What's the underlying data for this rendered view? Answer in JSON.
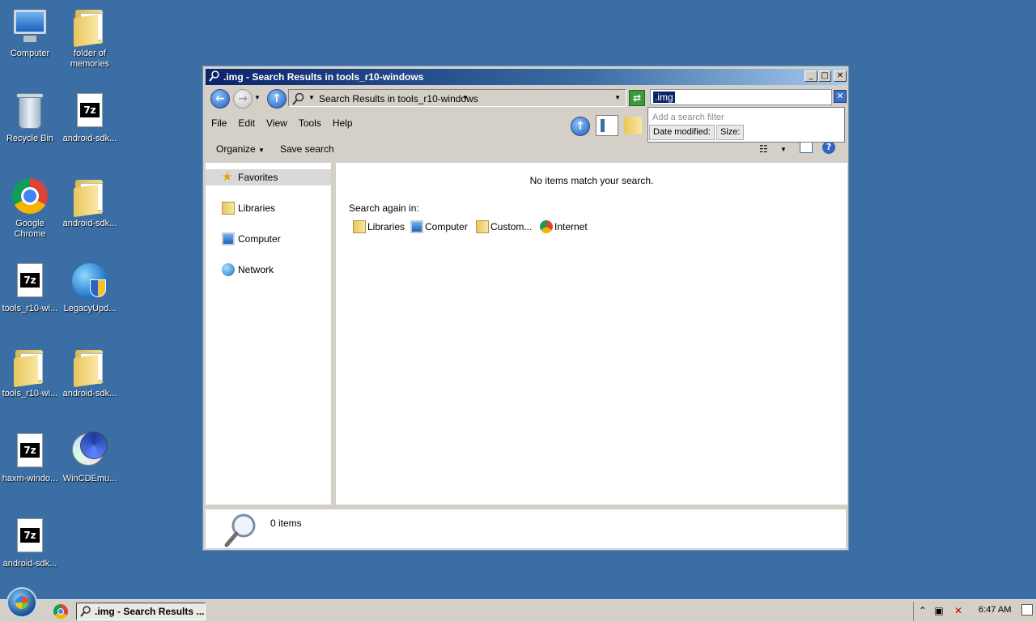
{
  "desktop": {
    "icons": [
      {
        "label": "Computer",
        "icon": "computer-icon"
      },
      {
        "label": "folder of memories",
        "icon": "folder-icon"
      },
      {
        "label": "Recycle Bin",
        "icon": "recycle-bin-icon"
      },
      {
        "label": "android-sdk...",
        "icon": "7z-archive-icon"
      },
      {
        "label": "Google Chrome",
        "icon": "chrome-icon"
      },
      {
        "label": "android-sdk...",
        "icon": "folder-icon"
      },
      {
        "label": "tools_r10-wi...",
        "icon": "7z-archive-icon"
      },
      {
        "label": "LegacyUpd...",
        "icon": "globe-shield-icon"
      },
      {
        "label": "tools_r10-wi...",
        "icon": "folder-icon"
      },
      {
        "label": "android-sdk...",
        "icon": "folder-icon"
      },
      {
        "label": "haxm-windo...",
        "icon": "7z-archive-icon"
      },
      {
        "label": "WinCDEmu...",
        "icon": "cd-shield-icon"
      },
      {
        "label": "android-sdk...",
        "icon": "7z-archive-icon"
      }
    ]
  },
  "window": {
    "title": ".img - Search Results in tools_r10-windows",
    "controls": {
      "minimize": "_",
      "maximize": "□",
      "close": "✕"
    },
    "address": "Search Results in tools_r10-windows",
    "search": {
      "value": ".img"
    },
    "menu": [
      "File",
      "Edit",
      "View",
      "Tools",
      "Help"
    ],
    "commands": {
      "organize": "Organize",
      "save_search": "Save search"
    },
    "nav": {
      "favorites": "Favorites",
      "libraries": "Libraries",
      "computer": "Computer",
      "network": "Network"
    },
    "main": {
      "no_items": "No items match your search.",
      "search_again_label": "Search again in:",
      "search_again": [
        "Libraries",
        "Computer",
        "Custom...",
        "Internet"
      ]
    },
    "status": {
      "count": "0 items"
    }
  },
  "search_dropdown": {
    "hint": "Add a search filter",
    "filters": [
      "Date modified:",
      "Size:"
    ]
  },
  "taskbar": {
    "task_label": ".img - Search Results ...",
    "clock": "6:47 AM"
  }
}
